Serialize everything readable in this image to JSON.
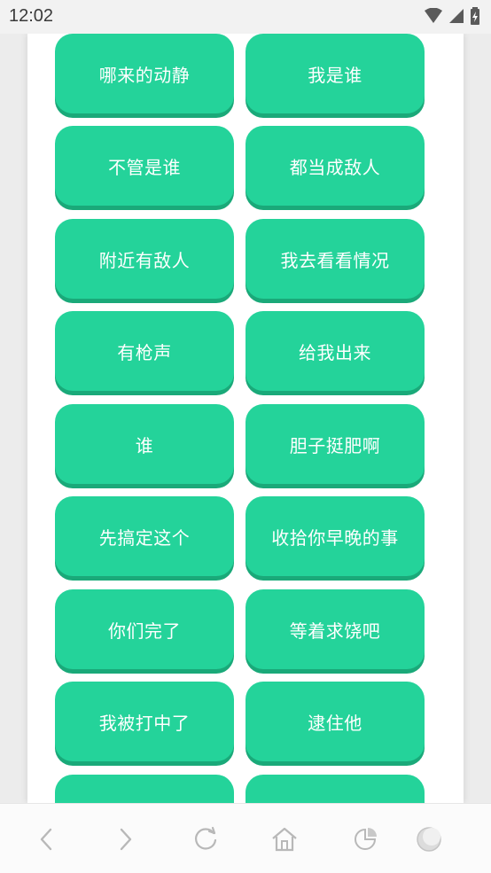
{
  "status": {
    "time": "12:02"
  },
  "buttons": [
    "哪来的动静",
    "我是谁",
    "不管是谁",
    "都当成敌人",
    "附近有敌人",
    "我去看看情况",
    "有枪声",
    "给我出来",
    "谁",
    "胆子挺肥啊",
    "先搞定这个",
    "收拾你早晚的事",
    "你们完了",
    "等着求饶吧",
    "我被打中了",
    "逮住他",
    "",
    ""
  ],
  "nav": {
    "icons": [
      "back-icon",
      "forward-icon",
      "refresh-icon",
      "home-icon",
      "tabs-icon",
      "menu-icon"
    ]
  },
  "colors": {
    "button": "#24d39a",
    "button_shadow": "#1aa979"
  }
}
